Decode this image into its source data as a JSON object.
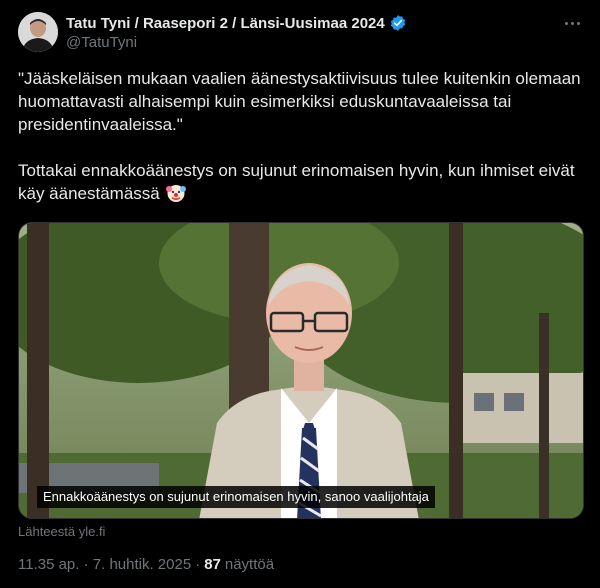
{
  "author": {
    "display_name": "Tatu Tyni / Raasepori 2 / Länsi-Uusimaa 2024",
    "handle": "@TatuTyni",
    "verified": true
  },
  "tweet": {
    "paragraph1": "\"Jääskeläisen mukaan vaalien äänestysaktiivisuus tulee kuitenkin olemaan huomattavasti alhaisempi kuin esimerkiksi eduskuntavaaleissa tai presidentinvaaleissa.\"",
    "paragraph2": "Tottakai ennakkoäänestys on sujunut erinomaisen hyvin, kun ihmiset eivät käy äänestämässä",
    "emoji": "clown-face-emoji"
  },
  "media": {
    "caption": "Ennakkoäänestys on sujunut erinomaisen hyvin, sanoo vaalijohtaja",
    "source": "Lähteestä yle.fi"
  },
  "meta": {
    "time": "11.35 ap. · 7. huhtik. 2025",
    "separator": "·",
    "views_count": "87",
    "views_label": "näyttöä"
  },
  "colors": {
    "background": "#000000",
    "text": "#e7e9ea",
    "secondary_text": "#71767b",
    "verified_badge": "#1d9bf0"
  },
  "icons": {
    "verified": "verified-badge-icon",
    "more": "more-options-icon"
  }
}
